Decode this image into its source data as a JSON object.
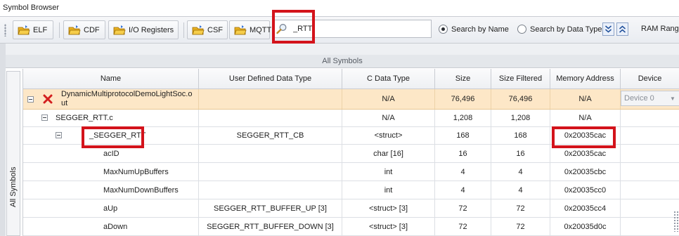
{
  "window": {
    "title": "Symbol Browser"
  },
  "toolbar": {
    "buttons": [
      {
        "label": "ELF"
      },
      {
        "label": "CDF"
      },
      {
        "label": "I/O Registers"
      },
      {
        "label": "CSF"
      },
      {
        "label": "MQTT"
      }
    ],
    "search": {
      "value": "_RTT",
      "icon": "search-icon"
    },
    "radios": [
      {
        "label": "Search by Name",
        "selected": true
      },
      {
        "label": "Search by Data Type",
        "selected": false
      }
    ],
    "ram_label": "RAM Range"
  },
  "panel": {
    "header": "All Symbols",
    "side_tab": "All Symbols"
  },
  "table": {
    "columns": [
      "Name",
      "User Defined Data Type",
      "C Data Type",
      "Size",
      "Size Filtered",
      "Memory Address",
      "Device"
    ],
    "rows": [
      {
        "name": "DynamicMultiprotocolDemoLightSoc.out",
        "name_line1": "DynamicMultiprotocolDemoLightSoc.o",
        "name_line2": "ut",
        "udt": "",
        "ctype": "N/A",
        "size": "76,496",
        "size_filtered": "76,496",
        "address": "N/A",
        "device": "Device 0",
        "level": 0,
        "expander": true,
        "status_icon": "error-x-icon"
      },
      {
        "name": "SEGGER_RTT.c",
        "udt": "",
        "ctype": "N/A",
        "size": "1,208",
        "size_filtered": "1,208",
        "address": "N/A",
        "device": "",
        "level": 1,
        "expander": true
      },
      {
        "name": "_SEGGER_RTT",
        "udt": "SEGGER_RTT_CB",
        "ctype": "<struct>",
        "size": "168",
        "size_filtered": "168",
        "address": "0x20035cac",
        "device": "",
        "level": 2,
        "expander": true
      },
      {
        "name": "acID",
        "udt": "",
        "ctype": "char [16]",
        "size": "16",
        "size_filtered": "16",
        "address": "0x20035cac",
        "device": "",
        "level": 3,
        "expander": false
      },
      {
        "name": "MaxNumUpBuffers",
        "udt": "",
        "ctype": "int",
        "size": "4",
        "size_filtered": "4",
        "address": "0x20035cbc",
        "device": "",
        "level": 3,
        "expander": false
      },
      {
        "name": "MaxNumDownBuffers",
        "udt": "",
        "ctype": "int",
        "size": "4",
        "size_filtered": "4",
        "address": "0x20035cc0",
        "device": "",
        "level": 3,
        "expander": false
      },
      {
        "name": "aUp",
        "udt": "SEGGER_RTT_BUFFER_UP [3]",
        "ctype": "<struct> [3]",
        "size": "72",
        "size_filtered": "72",
        "address": "0x20035cc4",
        "device": "",
        "level": 3,
        "expander": false
      },
      {
        "name": "aDown",
        "udt": "SEGGER_RTT_BUFFER_DOWN [3]",
        "ctype": "<struct> [3]",
        "size": "72",
        "size_filtered": "72",
        "address": "0x20035d0c",
        "device": "",
        "level": 3,
        "expander": false
      }
    ]
  },
  "colors": {
    "highlight": "#d3131b",
    "selected_row": "#fde7c7",
    "folder": "#e8b020"
  }
}
